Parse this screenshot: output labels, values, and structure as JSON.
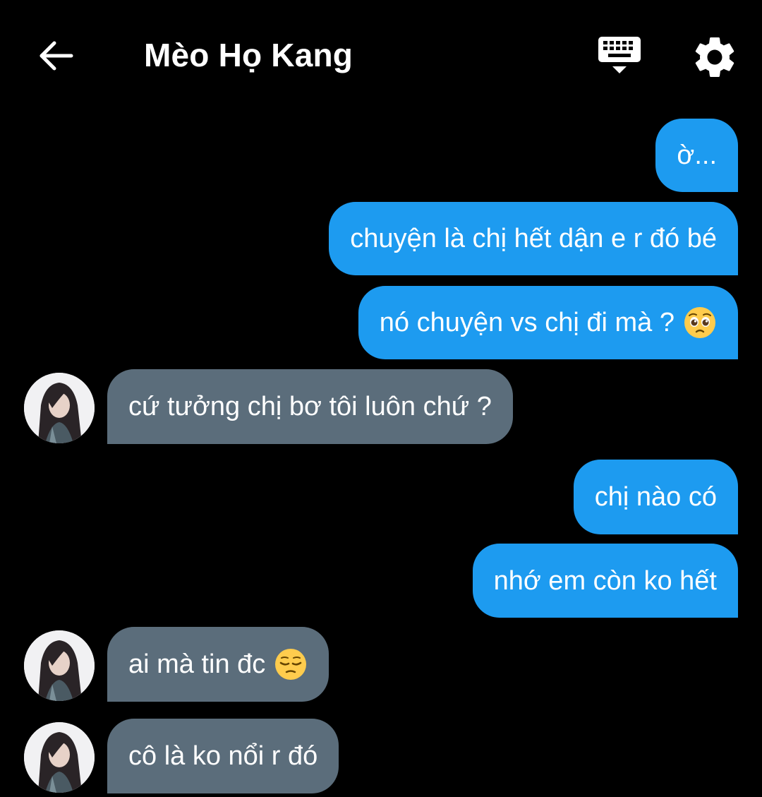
{
  "header": {
    "title": "Mèo Họ Kang",
    "back_icon": "arrow-left-icon",
    "keyboard_icon": "keyboard-icon",
    "settings_icon": "gear-icon"
  },
  "colors": {
    "background": "#000000",
    "outgoing_bubble": "#1d9bf0",
    "incoming_bubble": "#5b6d7b",
    "text": "#ffffff"
  },
  "messages": [
    {
      "side": "outgoing",
      "text": "ờ..."
    },
    {
      "side": "outgoing",
      "text": "chuyện là chị hết dận e r đó bé"
    },
    {
      "side": "outgoing",
      "text": "nó chuyện vs chị đi mà ?",
      "emoji": "pleading-face-emoji"
    },
    {
      "side": "incoming",
      "text": "cứ tưởng chị bơ tôi luôn chứ ?"
    },
    {
      "side": "outgoing",
      "text": "chị nào có"
    },
    {
      "side": "outgoing",
      "text": "nhớ em còn ko hết"
    },
    {
      "side": "incoming",
      "text": "ai mà tin đc",
      "emoji": "pensive-face-emoji"
    },
    {
      "side": "incoming",
      "text": "cô là ko nổi r đó"
    }
  ]
}
